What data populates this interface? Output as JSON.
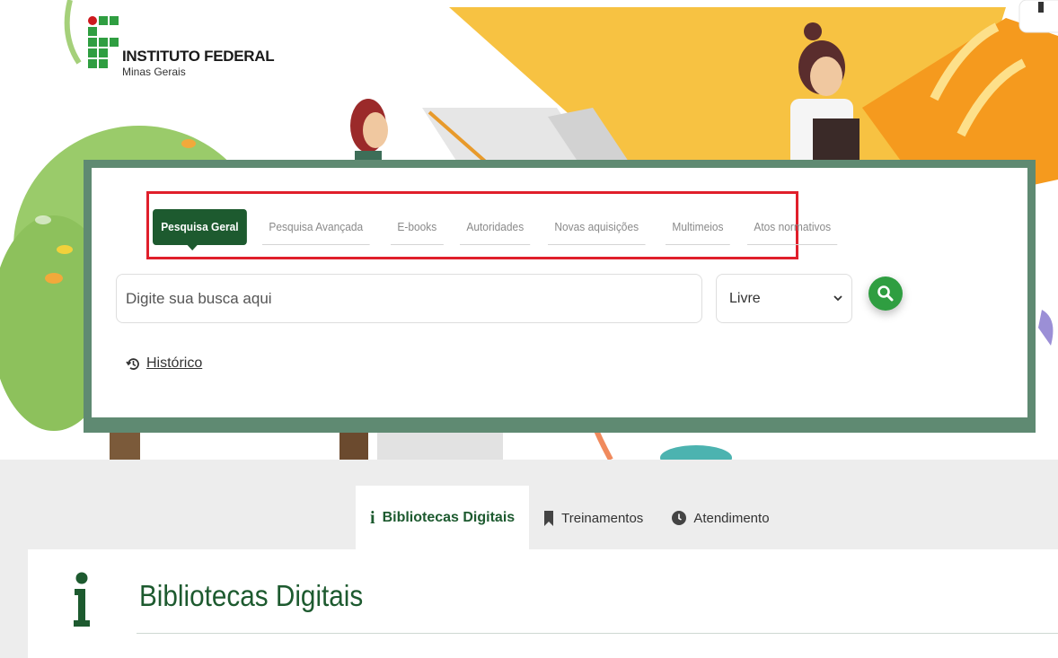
{
  "logo": {
    "title": "INSTITUTO FEDERAL",
    "subtitle": "Minas Gerais"
  },
  "search": {
    "tabs": [
      {
        "label": "Pesquisa Geral",
        "active": true
      },
      {
        "label": "Pesquisa Avançada",
        "active": false
      },
      {
        "label": "E-books",
        "active": false
      },
      {
        "label": "Autoridades",
        "active": false
      },
      {
        "label": "Novas aquisições",
        "active": false
      },
      {
        "label": "Multimeios",
        "active": false
      },
      {
        "label": "Atos normativos",
        "active": false
      }
    ],
    "placeholder": "Digite sua busca aqui",
    "select_value": "Livre",
    "history_label": "Histórico"
  },
  "info_tabs": [
    {
      "label": "Bibliotecas Digitais",
      "icon": "info-icon",
      "active": true
    },
    {
      "label": "Treinamentos",
      "icon": "bookmark-icon",
      "active": false
    },
    {
      "label": "Atendimento",
      "icon": "clock-icon",
      "active": false
    }
  ],
  "section": {
    "title": "Bibliotecas Digitais"
  },
  "colors": {
    "brand_green": "#2f9e41",
    "dark_green": "#1d5a2f",
    "logo_red": "#cd191e",
    "highlight_red": "#e01f2b",
    "frame_green": "#5f8a72"
  }
}
